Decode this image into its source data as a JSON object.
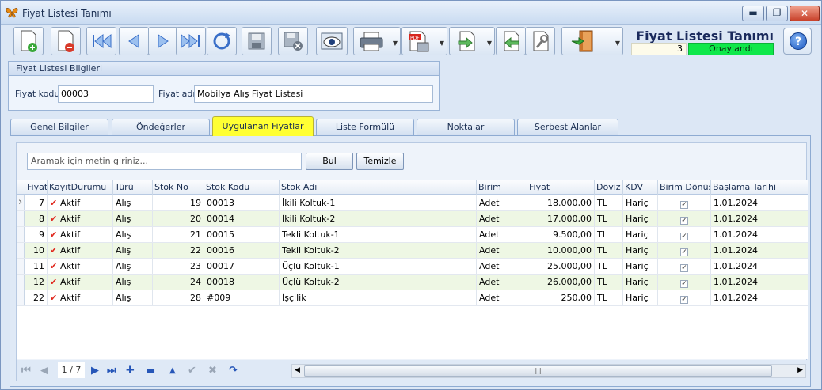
{
  "window": {
    "title": "Fiyat Listesi Tanımı",
    "min": "▬",
    "max": "❐",
    "close": "✕"
  },
  "header": {
    "title": "Fiyat Listesi Tanımı",
    "number": "3",
    "status": "Onaylandı",
    "status_color": "#0fe84a",
    "help": "?"
  },
  "group": {
    "title": "Fiyat Listesi Bilgileri",
    "code_label": "Fiyat kodu",
    "code_value": "00003",
    "name_label": "Fiyat adı",
    "name_value": "Mobilya Alış Fiyat Listesi"
  },
  "tabs": [
    "Genel Bilgiler",
    "Öndeğerler",
    "Uygulanan Fiyatlar",
    "Liste Formülü",
    "Noktalar",
    "Serbest Alanlar"
  ],
  "active_tab": "Uygulanan Fiyatlar",
  "search": {
    "placeholder": "Aramak için metin giriniz...",
    "find": "Bul",
    "clear": "Temizle"
  },
  "columns": [
    "Fiyat",
    "KayıtDurumu",
    "Türü",
    "Stok No",
    "Stok Kodu",
    "Stok Adı",
    "Birim",
    "Fiyat",
    "Döviz",
    "KDV",
    "Birim Dönüştü.",
    "Başlama Tarihi"
  ],
  "rows": [
    {
      "id": "7",
      "durum": "Aktif",
      "tur": "Alış",
      "stokno": "19",
      "kodu": "00013",
      "adi": "İkili Koltuk-1",
      "birim": "Adet",
      "fiyat": "18.000,00",
      "doviz": "TL",
      "kdv": "Hariç",
      "tarih": "1.01.2024"
    },
    {
      "id": "8",
      "durum": "Aktif",
      "tur": "Alış",
      "stokno": "20",
      "kodu": "00014",
      "adi": "İkili Koltuk-2",
      "birim": "Adet",
      "fiyat": "17.000,00",
      "doviz": "TL",
      "kdv": "Hariç",
      "tarih": "1.01.2024"
    },
    {
      "id": "9",
      "durum": "Aktif",
      "tur": "Alış",
      "stokno": "21",
      "kodu": "00015",
      "adi": "Tekli Koltuk-1",
      "birim": "Adet",
      "fiyat": "9.500,00",
      "doviz": "TL",
      "kdv": "Hariç",
      "tarih": "1.01.2024"
    },
    {
      "id": "10",
      "durum": "Aktif",
      "tur": "Alış",
      "stokno": "22",
      "kodu": "00016",
      "adi": "Tekli Koltuk-2",
      "birim": "Adet",
      "fiyat": "10.000,00",
      "doviz": "TL",
      "kdv": "Hariç",
      "tarih": "1.01.2024"
    },
    {
      "id": "11",
      "durum": "Aktif",
      "tur": "Alış",
      "stokno": "23",
      "kodu": "00017",
      "adi": "Üçlü Koltuk-1",
      "birim": "Adet",
      "fiyat": "25.000,00",
      "doviz": "TL",
      "kdv": "Hariç",
      "tarih": "1.01.2024"
    },
    {
      "id": "12",
      "durum": "Aktif",
      "tur": "Alış",
      "stokno": "24",
      "kodu": "00018",
      "adi": "Üçlü Koltuk-2",
      "birim": "Adet",
      "fiyat": "26.000,00",
      "doviz": "TL",
      "kdv": "Hariç",
      "tarih": "1.01.2024"
    },
    {
      "id": "22",
      "durum": "Aktif",
      "tur": "Alış",
      "stokno": "28",
      "kodu": "#009",
      "adi": "İşçilik",
      "birim": "Adet",
      "fiyat": "250,00",
      "doviz": "TL",
      "kdv": "Hariç",
      "tarih": "1.01.2024"
    }
  ],
  "navigator": {
    "page": "1 / 7"
  },
  "icons": {
    "toolbar": [
      "new-document-icon",
      "delete-document-icon",
      "first-record-icon",
      "previous-record-icon",
      "next-record-icon",
      "last-record-icon",
      "refresh-icon",
      "save-icon",
      "save-cancel-icon",
      "preview-icon",
      "print-icon",
      "pdf-export-icon",
      "export-icon",
      "import-icon",
      "settings-icon",
      "exit-icon"
    ]
  }
}
